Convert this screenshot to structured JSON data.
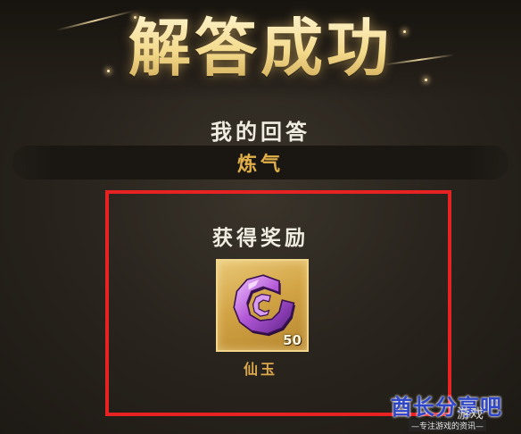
{
  "title": "解答成功",
  "answer": {
    "label": "我的回答",
    "value": "炼气"
  },
  "reward": {
    "title": "获得奖励",
    "item_name": "仙玉",
    "count": "50",
    "icon": "purple-jade-icon"
  },
  "watermark": {
    "main": "酋长分享吧",
    "secondary": "游戏",
    "small": "—专注游戏的资讯—"
  },
  "colors": {
    "highlight_box": "#e62222",
    "answer_value": "#e2b049",
    "reward_name": "#dba84a",
    "watermark": "#2f46c8"
  }
}
